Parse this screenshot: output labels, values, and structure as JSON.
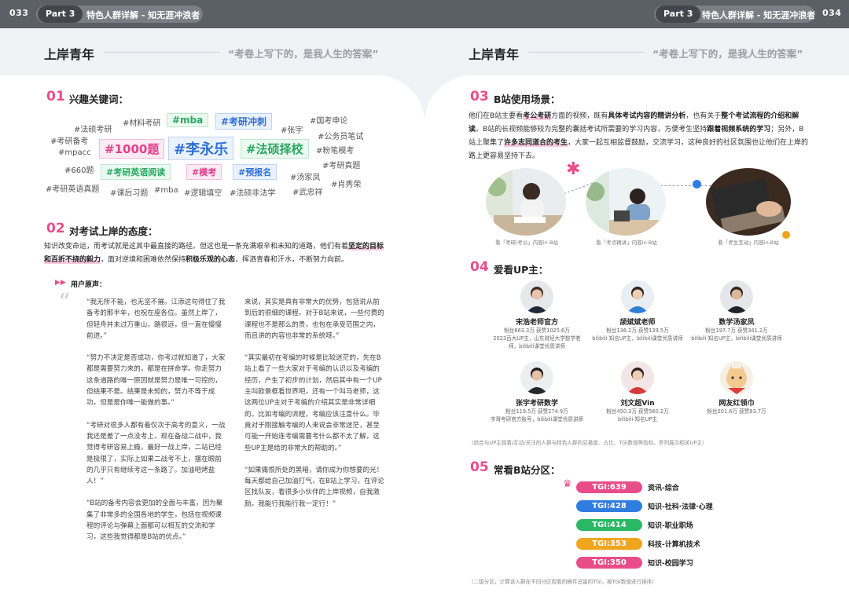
{
  "header": {
    "left": {
      "page": "033",
      "part": "Part 3",
      "chapter": "特色人群详解 - 知无涯冲浪者"
    },
    "right": {
      "page": "034",
      "part": "Part 3",
      "chapter": "特色人群详解 - 知无涯冲浪者"
    }
  },
  "left_page": {
    "title": "上岸青年",
    "quote": "“考卷上写下的，是我人生的答案”",
    "s01": {
      "num": "01",
      "title": "兴趣关键词："
    },
    "keywords": {
      "plain": [
        "#法硕考研",
        "#材料考研",
        "#张宇",
        "#国考申论",
        "#考研备考",
        "#公务员笔试",
        "#mpacc",
        "#粉笔模考",
        "#660题",
        "#考研真题",
        "#汤家凤",
        "#考研英语真题",
        "#课后习题",
        "#mba",
        "#逻辑填空",
        "#法硕非法学",
        "#武忠祥",
        "#肖秀荣"
      ],
      "boxed": [
        "#mba",
        "#考研冲刺",
        "#1000题",
        "#李永乐",
        "#法硕择校",
        "#考研英语阅读",
        "#模考",
        "#预报名"
      ]
    },
    "s02": {
      "num": "02",
      "title": "对考试上岸的态度："
    },
    "attitude": {
      "t1": "知识改变命运，而考试就是这其中最直接的路径。但这也是一条充满艰辛和未知的道路，他们有着",
      "h1": "坚定的目标和百折不挠的毅力",
      "t2": "，面对逆境和困难依然保持",
      "b1": "积极乐观的心态",
      "t3": "，挥洒青春和汗水，不断努力向前。"
    },
    "voice_label": "用户原声：",
    "quotes_col1": [
      "“我无所不能，也无坚不摧。江添这句得住了我备考的那半年，也祝在座各位。虽然上岸了，但轻舟并未过万重山，路很远，但一直在慢慢前进。”",
      "“努力不决定是否成功，你考过就知道了，大家都是需要努力来的，都是在拼命学。你走努力这条道路的唯一原因就是努力是唯一可控的，但结果不是。结果是未知的，努力不等于成功，但是是你唯一能做的事。”",
      "“考研对很多人都有着仅次于高考的意义，一战我还是差了一点没考上，现在备战二战中，我觉得考研容易上瘾，最好一战上岸，二站已经是极限了，实际上如果二战考不上，摆在眼前的几乎只有继续考这一条路了。加油吧烤盐人！”",
      "“B站的备考内容会更加的全面与丰富，因为聚集了非常多的全国各地的学生，包括在视频课程的评论与弹幕上面都可以相互的交流和学习，这些我觉得都是B站的优点。”"
    ],
    "quotes_col2": [
      "来说，其实是具有非常大的优势，包括说从前到后的很细的课程。对于B站来说，一些付费的课程也不是那么的贵，也包在承受范围之内，而且讲的内容也非常的系统呀。”",
      "“其实最初在考编的时候是比较迷茫的，先在B站上看了一些大家对于考编的认识以及考编的经历，产生了初步的计划，然后其中有一个UP主叫欧景框看世界吧，还有一个叫马老师，这这两位UP主对于考编的介绍其实是非常详细的。比如考编的流程，考编应该注意什么。毕竟对于刚接触考编的人来说会非常迷茫，甚至可能一开始连考编需要考什么都不太了解，这些UP主是给的非常大的帮助的。”",
      "“如果痛恨所处的黑暗，请你成为你想要的光！每天都给自己加油打气，在B站上学习，在评论区找队友，看很多小伙伴的上岸视频，自我激励。我能行我能行我一定行！”"
    ]
  },
  "right_page": {
    "title": "上岸青年",
    "quote": "“考卷上写下的，是我人生的答案”",
    "s03": {
      "num": "03",
      "title": "B站使用场景："
    },
    "scene": {
      "t1": "他们在B站主要看",
      "h1": "考公考研",
      "t2": "方面的视频，既有",
      "b1": "具体考试内容的精讲分析",
      "t3": "，也有关于",
      "b2": "整个考试流程的介绍和解读",
      "t4": "。B站的长视频能够较为完整的囊括考试所需要的学习内容，方便考生坚持",
      "b3": "跟着视频系统的学习",
      "t5": "；另外，B站上聚集了",
      "h2": "许多志同道合的考生",
      "t6": "，大家一起互相监督鼓励，交流学习，这种良好的社区氛围也让他们在上岸的路上更容易坚持下去。"
    },
    "photo_captions": [
      "看「考研/考公」内容in B站",
      "看「考点精讲」内容in B站",
      "看「考生互动」内容in B站"
    ],
    "s04": {
      "num": "04",
      "title": "爱看UP主："
    },
    "ups": [
      {
        "name": "宋浩老师官方",
        "desc": "粉丝863.3万 获赞1025.6万\n2023百大UP主，山东财经大学数学老师，bilibili课堂优质讲师"
      },
      {
        "name": "颉斌斌老师",
        "desc": "粉丝136.2万 获赞139.5万\nbilibili 知名UP主，bilibili课堂优质讲师"
      },
      {
        "name": "数学汤家凤",
        "desc": "粉丝197.7万 获赞341.2万\nbilibili 知名UP主，bilibili课堂优质讲师"
      },
      {
        "name": "张宇考研数学",
        "desc": "粉丝119.5万 获赞274.9万\n宇哥考研官方账号，bilibili课堂优质讲师"
      },
      {
        "name": "刘文超Vin",
        "desc": "粉丝450.3万 获赞560.2万\nbilibili 知名UP主"
      },
      {
        "name": "网友红领巾",
        "desc": "粉丝201.6万 获赞83.7万"
      }
    ],
    "ups_note": "（综合与UP主观看/互动/关注的人群与特色人群的显著度、占比、TGI数值等指标，罗列展示相关UP主）",
    "s05": {
      "num": "05",
      "title": "常看B站分区："
    },
    "tgi": [
      {
        "tgi": "TGI:639",
        "label": "资讯-综合",
        "color": "#e84d8a"
      },
      {
        "tgi": "TGI:428",
        "label": "知识-社科·法律·心理",
        "color": "#2f7de1"
      },
      {
        "tgi": "TGI:414",
        "label": "知识-职业职场",
        "color": "#2ab865"
      },
      {
        "tgi": "TGI:353",
        "label": "科技-计算机技术",
        "color": "#f0a51f"
      },
      {
        "tgi": "TGI:350",
        "label": "知识-校园学习",
        "color": "#e84d8a"
      }
    ],
    "tgi_note": "（二级分区，计算该人群在不同分区观看的稿件总量的TGI，按TGI数值进行排序）"
  }
}
